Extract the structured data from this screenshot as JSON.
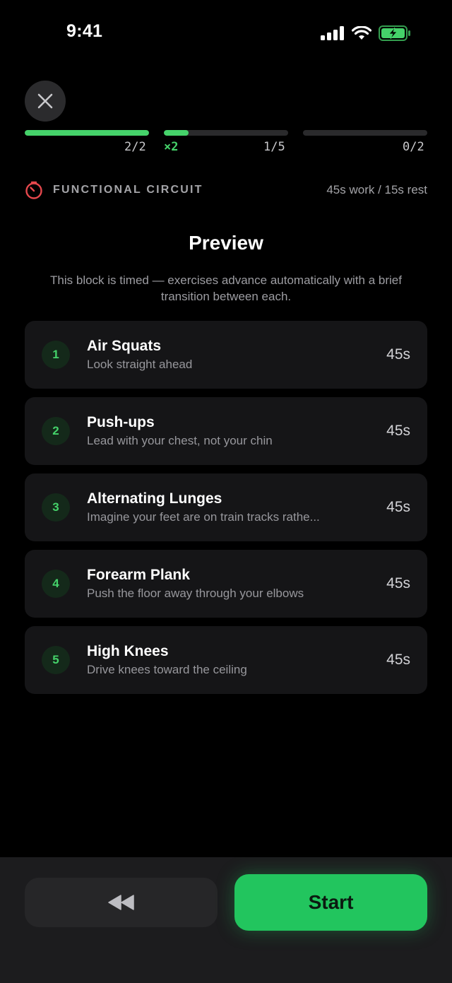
{
  "status_bar": {
    "time": "9:41"
  },
  "progress": {
    "segments": [
      {
        "label": "2/2",
        "fill": 1.0
      },
      {
        "label": "1/5",
        "multiplier": "×2",
        "fill": 0.2
      },
      {
        "label": "0/2",
        "fill": 0.0
      }
    ]
  },
  "circuit": {
    "title": "FUNCTIONAL CIRCUIT",
    "detail": "45s work / 15s rest",
    "accent": "#e5484d"
  },
  "preview": {
    "title": "Preview",
    "description": "This block is timed — exercises advance automatically with a brief transition between each."
  },
  "exercises": [
    {
      "number": "1",
      "name": "Air Squats",
      "cue": "Look straight ahead",
      "duration": "45s"
    },
    {
      "number": "2",
      "name": "Push-ups",
      "cue": "Lead with your chest, not your chin",
      "duration": "45s"
    },
    {
      "number": "3",
      "name": "Alternating Lunges",
      "cue": "Imagine your feet are on train tracks rathe...",
      "duration": "45s"
    },
    {
      "number": "4",
      "name": "Forearm Plank",
      "cue": "Push the floor away through your elbows",
      "duration": "45s"
    },
    {
      "number": "5",
      "name": "High Knees",
      "cue": "Drive knees toward the ceiling",
      "duration": "45s"
    }
  ],
  "footer": {
    "rewind_icon": "rewind-icon",
    "start_label": "Start"
  },
  "colors": {
    "accent_green": "#45d26a",
    "start_green": "#22c55e",
    "background": "#000000"
  }
}
